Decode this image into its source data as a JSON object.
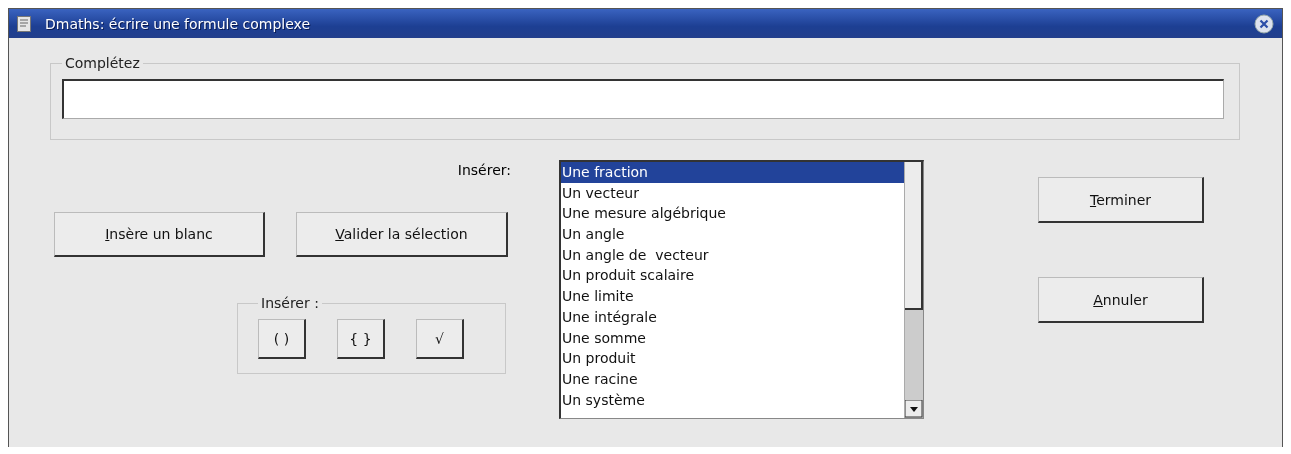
{
  "window": {
    "title": "Dmaths: écrire une formule complexe"
  },
  "formula_group": {
    "legend": "Complétez"
  },
  "insert_label": "Insérer:",
  "left_buttons": [
    {
      "mnemonic": "I",
      "label": "nsère un blanc"
    },
    {
      "mnemonic": "V",
      "label": "alider la sélection"
    }
  ],
  "brackets_group": {
    "legend": "Insérer :",
    "buttons": [
      "( )",
      "{ }",
      "√"
    ]
  },
  "list": [
    {
      "label": "Une fraction",
      "selected": true
    },
    {
      "label": "Un vecteur",
      "selected": false
    },
    {
      "label": "Une mesure algébrique",
      "selected": false
    },
    {
      "label": "Un angle",
      "selected": false
    },
    {
      "label": "Un angle de  vecteur",
      "selected": false
    },
    {
      "label": "Un produit scalaire",
      "selected": false
    },
    {
      "label": "Une limite",
      "selected": false
    },
    {
      "label": "Une intégrale",
      "selected": false
    },
    {
      "label": "Une somme",
      "selected": false
    },
    {
      "label": "Un produit",
      "selected": false
    },
    {
      "label": "Une racine",
      "selected": false
    },
    {
      "label": "Un système",
      "selected": false
    }
  ],
  "right_buttons": [
    {
      "mnemonic": "T",
      "label": "erminer"
    },
    {
      "mnemonic": "A",
      "label": "nnuler"
    }
  ]
}
